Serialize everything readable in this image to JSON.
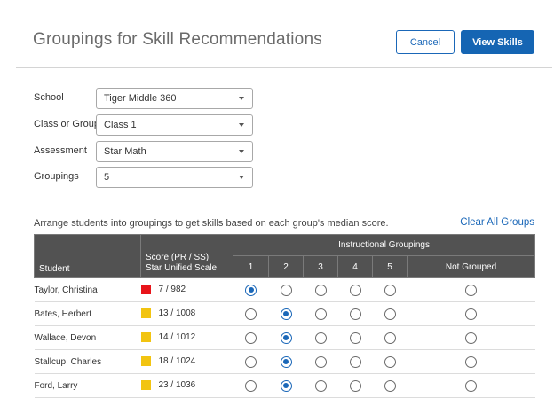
{
  "header": {
    "title": "Groupings for Skill Recommendations",
    "cancel_label": "Cancel",
    "view_skills_label": "View Skills"
  },
  "form": {
    "fields": [
      {
        "label": "School",
        "value": "Tiger Middle 360"
      },
      {
        "label": "Class or Group",
        "value": "Class 1"
      },
      {
        "label": "Assessment",
        "value": "Star Math"
      },
      {
        "label": "Groupings",
        "value": "5"
      }
    ]
  },
  "instructions": "Arrange students into groupings to get skills based on each group's median score.",
  "clear_all_label": "Clear All Groups",
  "table": {
    "headers": {
      "student": "Student",
      "score_line1": "Score (PR / SS)",
      "score_line2": "Star Unified Scale",
      "instructional_groupings": "Instructional Groupings",
      "groups": [
        "1",
        "2",
        "3",
        "4",
        "5"
      ],
      "not_grouped": "Not Grouped"
    },
    "rows": [
      {
        "student": "Taylor, Christina",
        "score": "7 / 982",
        "color": "#e8141a",
        "selected": 0
      },
      {
        "student": "Bates, Herbert",
        "score": "13 / 1008",
        "color": "#f2c411",
        "selected": 1
      },
      {
        "student": "Wallace, Devon",
        "score": "14 / 1012",
        "color": "#f2c411",
        "selected": 1
      },
      {
        "student": "Stallcup, Charles",
        "score": "18 / 1024",
        "color": "#f2c411",
        "selected": 1
      },
      {
        "student": "Ford, Larry",
        "score": "23 / 1036",
        "color": "#f2c411",
        "selected": 1
      }
    ]
  }
}
